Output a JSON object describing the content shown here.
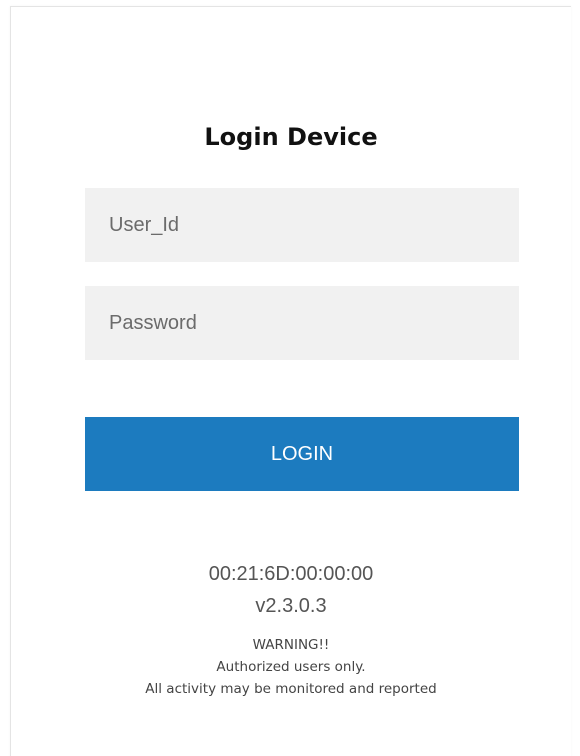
{
  "login": {
    "title": "Login Device",
    "user_placeholder": "User_Id",
    "password_placeholder": "Password",
    "button_label": "LOGIN"
  },
  "device": {
    "mac_address": "00:21:6D:00:00:00",
    "version": "v2.3.0.3"
  },
  "warning": {
    "heading": "WARNING!!",
    "line1": "Authorized users only.",
    "line2": "All activity may be monitored and reported"
  },
  "colors": {
    "accent": "#1c7bbf",
    "field_background": "#f1f1f1"
  }
}
